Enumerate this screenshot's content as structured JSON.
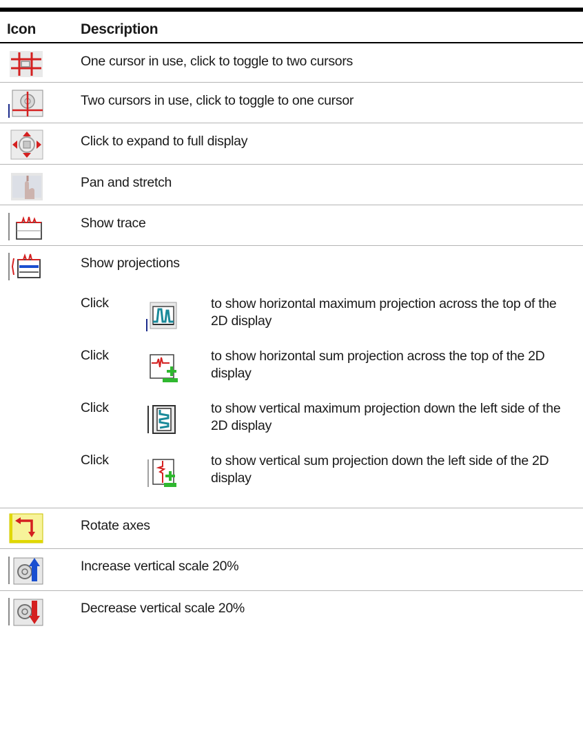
{
  "header": {
    "icon_label": "Icon",
    "description_label": "Description"
  },
  "rows": [
    {
      "icon": "one-cursor-icon",
      "text": "One cursor in use, click to toggle to two cursors"
    },
    {
      "icon": "two-cursors-icon",
      "text": "Two cursors in use, click to toggle to one cursor"
    },
    {
      "icon": "expand-full-display-icon",
      "text": "Click to expand to full display"
    },
    {
      "icon": "pan-stretch-icon",
      "text": "Pan and stretch"
    },
    {
      "icon": "show-trace-icon",
      "text": "Show trace"
    },
    {
      "icon": "show-projections-icon",
      "text": "Show projections"
    }
  ],
  "projections": [
    {
      "click": "Click",
      "icon": "horizontal-max-projection-icon",
      "text": "to show horizontal maximum projection across the top of the 2D display"
    },
    {
      "click": "Click",
      "icon": "horizontal-sum-projection-icon",
      "text": "to show horizontal sum projection across the top of the 2D display"
    },
    {
      "click": "Click",
      "icon": "vertical-max-projection-icon",
      "text": "to show vertical maximum projection down the left side of the 2D display"
    },
    {
      "click": "Click",
      "icon": "vertical-sum-projection-icon",
      "text": "to show vertical sum projection down the left side of the 2D display"
    }
  ],
  "rows_after": [
    {
      "icon": "rotate-axes-icon",
      "text": "Rotate axes"
    },
    {
      "icon": "increase-vertical-scale-icon",
      "text": "Increase vertical scale 20%"
    },
    {
      "icon": "decrease-vertical-scale-icon",
      "text": "Decrease vertical scale 20%"
    }
  ],
  "colors": {
    "rule": "#000000",
    "separator": "#b4b4b4",
    "icon_red": "#d42020",
    "icon_blue": "#1a4fd0",
    "icon_green": "#2fb82f",
    "icon_yellow": "#f2e800"
  }
}
